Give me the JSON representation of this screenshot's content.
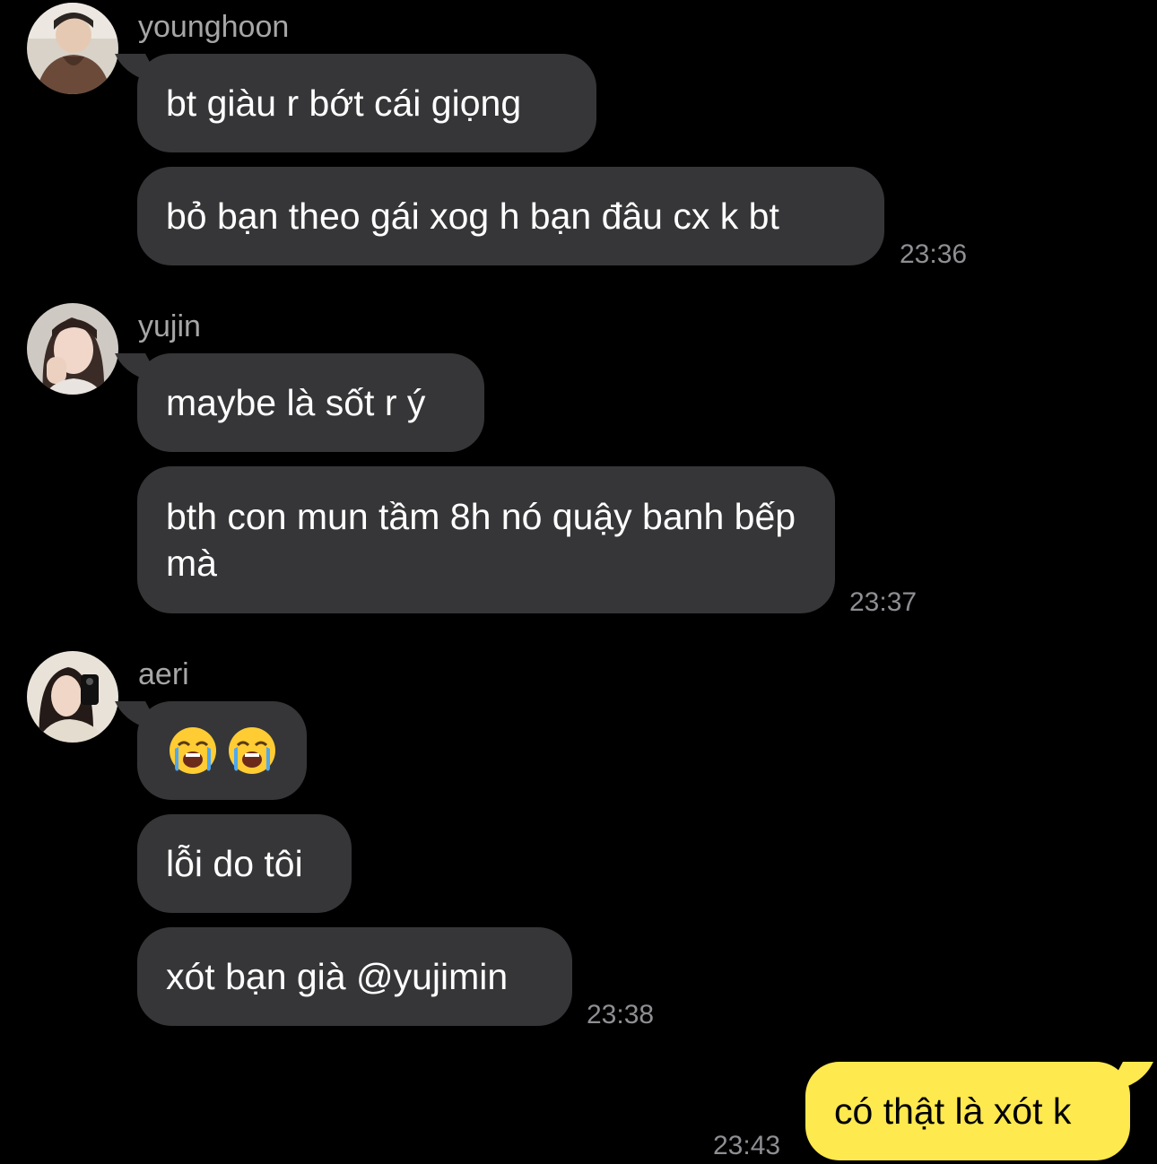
{
  "colors": {
    "background": "#000000",
    "incoming_bubble": "#363638",
    "outgoing_bubble": "#fee94e",
    "sender_name": "#a6a6a6",
    "timestamp": "#8e8e93"
  },
  "groups": [
    {
      "sender": "younghoon",
      "avatar_icon": "avatar-photo-younghoon",
      "messages": [
        {
          "text": "bt giàu r bớt cái giọng"
        },
        {
          "text": "bỏ bạn theo gái xog h bạn đâu cx k bt"
        }
      ],
      "time": "23:36"
    },
    {
      "sender": "yujin",
      "avatar_icon": "avatar-photo-yujin",
      "messages": [
        {
          "text": "maybe là sốt r ý"
        },
        {
          "text": "bth con mun tầm 8h nó quậy banh bếp mà"
        }
      ],
      "time": "23:37"
    },
    {
      "sender": "aeri",
      "avatar_icon": "avatar-photo-aeri",
      "messages": [
        {
          "emoji": [
            "loudly-crying-face-icon",
            "loudly-crying-face-icon"
          ]
        },
        {
          "text": "lỗi do tôi"
        },
        {
          "text": "xót bạn già @yujimin"
        }
      ],
      "time": "23:38"
    }
  ],
  "outgoing": {
    "text": "có thật là xót k",
    "time": "23:43"
  }
}
